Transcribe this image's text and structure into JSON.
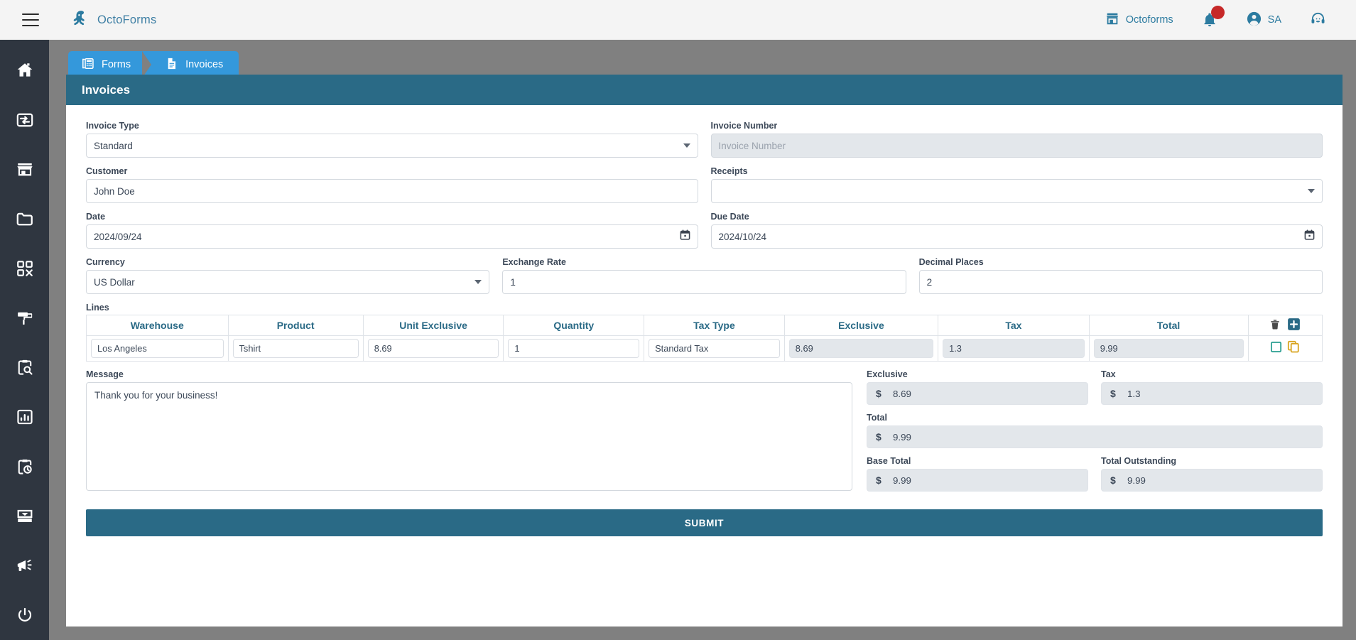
{
  "app": {
    "logo_icon": "octopus-icon",
    "name": "OctoForms",
    "menu_icon": "hamburger-menu-icon"
  },
  "topbar": {
    "org": {
      "icon": "store-icon",
      "label": "Octoforms"
    },
    "notifications": {
      "icon": "bell-icon",
      "badge": ""
    },
    "account": {
      "icon": "account-circle-icon",
      "label": "SA"
    },
    "support": {
      "icon": "headset-icon"
    }
  },
  "sidebar": {
    "items": [
      {
        "icon": "home-icon",
        "name": "sidebar-item-home"
      },
      {
        "icon": "dashboard-card-icon",
        "name": "sidebar-item-dashboard"
      },
      {
        "icon": "store-icon",
        "name": "sidebar-item-store"
      },
      {
        "icon": "folder-icon",
        "name": "sidebar-item-folder"
      },
      {
        "icon": "qr-code-icon",
        "name": "sidebar-item-qr"
      },
      {
        "icon": "paint-roller-icon",
        "name": "sidebar-item-design"
      },
      {
        "icon": "clipboard-search-icon",
        "name": "sidebar-item-audit"
      },
      {
        "icon": "bar-chart-icon",
        "name": "sidebar-item-reports"
      },
      {
        "icon": "clipboard-clock-icon",
        "name": "sidebar-item-history"
      },
      {
        "icon": "inbox-icon",
        "name": "sidebar-item-inbox"
      },
      {
        "icon": "megaphone-icon",
        "name": "sidebar-item-announcements"
      },
      {
        "icon": "power-icon",
        "name": "sidebar-item-logout"
      }
    ]
  },
  "tabs": [
    {
      "label": "Forms",
      "icon": "forms-icon",
      "active": false
    },
    {
      "label": "Invoices",
      "icon": "document-icon",
      "active": true
    }
  ],
  "card": {
    "title": "Invoices"
  },
  "form": {
    "invoice_type": {
      "label": "Invoice Type",
      "value": "Standard"
    },
    "invoice_number": {
      "label": "Invoice Number",
      "value": "",
      "placeholder": "Invoice Number"
    },
    "customer": {
      "label": "Customer",
      "value": "John Doe"
    },
    "receipts": {
      "label": "Receipts",
      "value": ""
    },
    "date": {
      "label": "Date",
      "value": "2024/09/24"
    },
    "due_date": {
      "label": "Due Date",
      "value": "2024/10/24"
    },
    "currency": {
      "label": "Currency",
      "value": "US Dollar"
    },
    "exchange_rate": {
      "label": "Exchange Rate",
      "value": "1"
    },
    "decimal_places": {
      "label": "Decimal Places",
      "value": "2"
    }
  },
  "lines": {
    "label": "Lines",
    "columns": [
      "Warehouse",
      "Product",
      "Unit Exclusive",
      "Quantity",
      "Tax Type",
      "Exclusive",
      "Tax",
      "Total"
    ],
    "header_actions": [
      {
        "icon": "trash-icon",
        "name": "delete-line-button"
      },
      {
        "icon": "plus-icon",
        "name": "add-line-button"
      }
    ],
    "rows": [
      {
        "warehouse": "Los Angeles",
        "product": "Tshirt",
        "unit_exclusive": "8.69",
        "quantity": "1",
        "tax_type": "Standard Tax",
        "exclusive": "8.69",
        "tax": "1.3",
        "total": "9.99",
        "row_actions": [
          {
            "icon": "select-square-icon",
            "name": "select-row-checkbox"
          },
          {
            "icon": "copy-icon",
            "name": "duplicate-row-button"
          }
        ]
      }
    ]
  },
  "message": {
    "label": "Message",
    "value": "Thank you for your business!"
  },
  "totals": {
    "currency_symbol": "$",
    "exclusive": {
      "label": "Exclusive",
      "value": "8.69"
    },
    "tax": {
      "label": "Tax",
      "value": "1.3"
    },
    "total": {
      "label": "Total",
      "value": "9.99"
    },
    "base_total": {
      "label": "Base Total",
      "value": "9.99"
    },
    "total_outstanding": {
      "label": "Total Outstanding",
      "value": "9.99"
    }
  },
  "actions": {
    "submit_label": "SUBMIT"
  },
  "colors": {
    "accent_teal": "#2a6a86",
    "tab_blue": "#3498db",
    "sidebar_dark": "#2f3640",
    "page_gray": "#808080",
    "badge_red": "#c62828",
    "select_green": "#1f9a8c",
    "copy_orange": "#d9a520"
  }
}
